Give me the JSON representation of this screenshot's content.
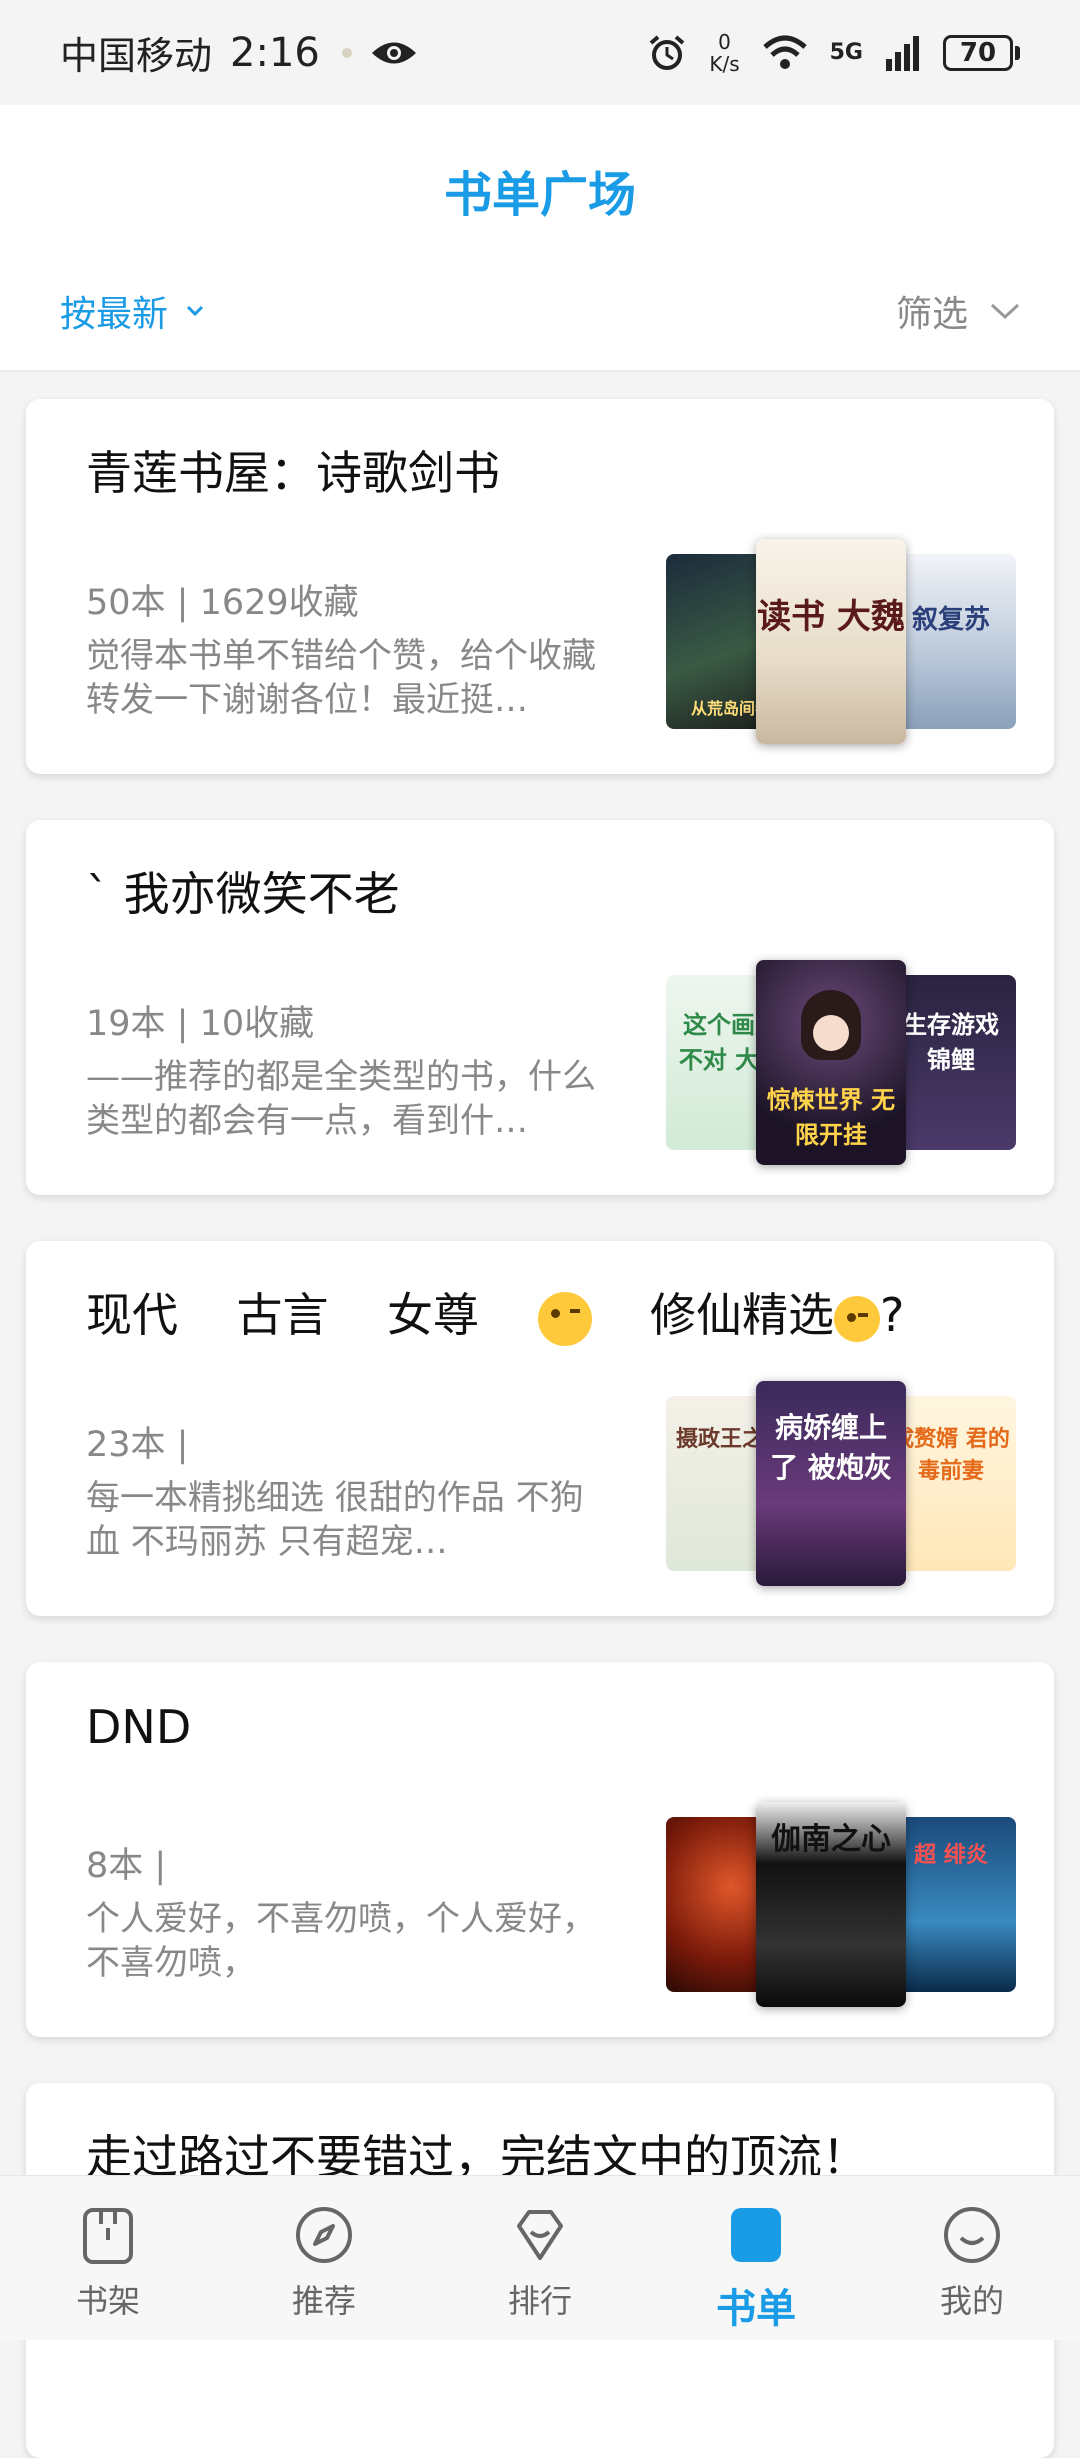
{
  "status_bar": {
    "carrier": "中国移动",
    "time": "2:16",
    "net_speed_value": "0",
    "net_speed_unit": "K/s",
    "network": "5G",
    "battery": "70"
  },
  "header": {
    "title": "书单广场",
    "sort_label": "按最新",
    "filter_label": "筛选"
  },
  "booklists": [
    {
      "title": "青莲书屋：诗歌剑书",
      "meta": "50本 | 1629收藏",
      "description": "觉得本书单不错给个赞，给个收藏转发一下谢谢各位！最近挺…",
      "covers": [
        {
          "text": "从荒岛间卷"
        },
        {
          "text": "读书 大魏"
        },
        {
          "text": "叙复苏"
        }
      ]
    },
    {
      "title": "ˋ 我亦微笑不老",
      "meta": "19本 | 10收藏",
      "description": "——推荐的都是全类型的书，什么类型的都会有一点，看到什…",
      "covers": [
        {
          "text": "这个画风不对 大佬"
        },
        {
          "text": "惊悚世界 无限开挂"
        },
        {
          "text": "生存游戏 锦鲤"
        }
      ]
    },
    {
      "title_parts": [
        "现代",
        "古言",
        "女尊",
        "修仙精选",
        "?"
      ],
      "meta": "23本 |",
      "description": "每一本精挑细选  很甜的作品 不狗血  不玛丽苏  只有超宠…",
      "covers": [
        {
          "text": "摄政王之后"
        },
        {
          "text": "病娇缠上了 被炮灰"
        },
        {
          "text": "成赘婿 君的 毒前妻"
        }
      ]
    },
    {
      "title": "DND",
      "meta": "8本 |",
      "description": "个人爱好，不喜勿喷，个人爱好，不喜勿喷，",
      "covers": [
        {
          "text": ""
        },
        {
          "text": "伽南之心"
        },
        {
          "text": "超 绯炎"
        }
      ]
    },
    {
      "title": "走过路过不要错过，完结文中的顶流！"
    }
  ],
  "tabbar": {
    "items": [
      {
        "label": "书架",
        "icon": "bookshelf-icon"
      },
      {
        "label": "推荐",
        "icon": "compass-icon"
      },
      {
        "label": "排行",
        "icon": "ranking-icon"
      },
      {
        "label": "书单",
        "icon": "booklist-icon"
      },
      {
        "label": "我的",
        "icon": "smile-icon"
      }
    ],
    "active_index": 3
  },
  "colors": {
    "accent": "#1a9be6",
    "muted": "#888888"
  }
}
